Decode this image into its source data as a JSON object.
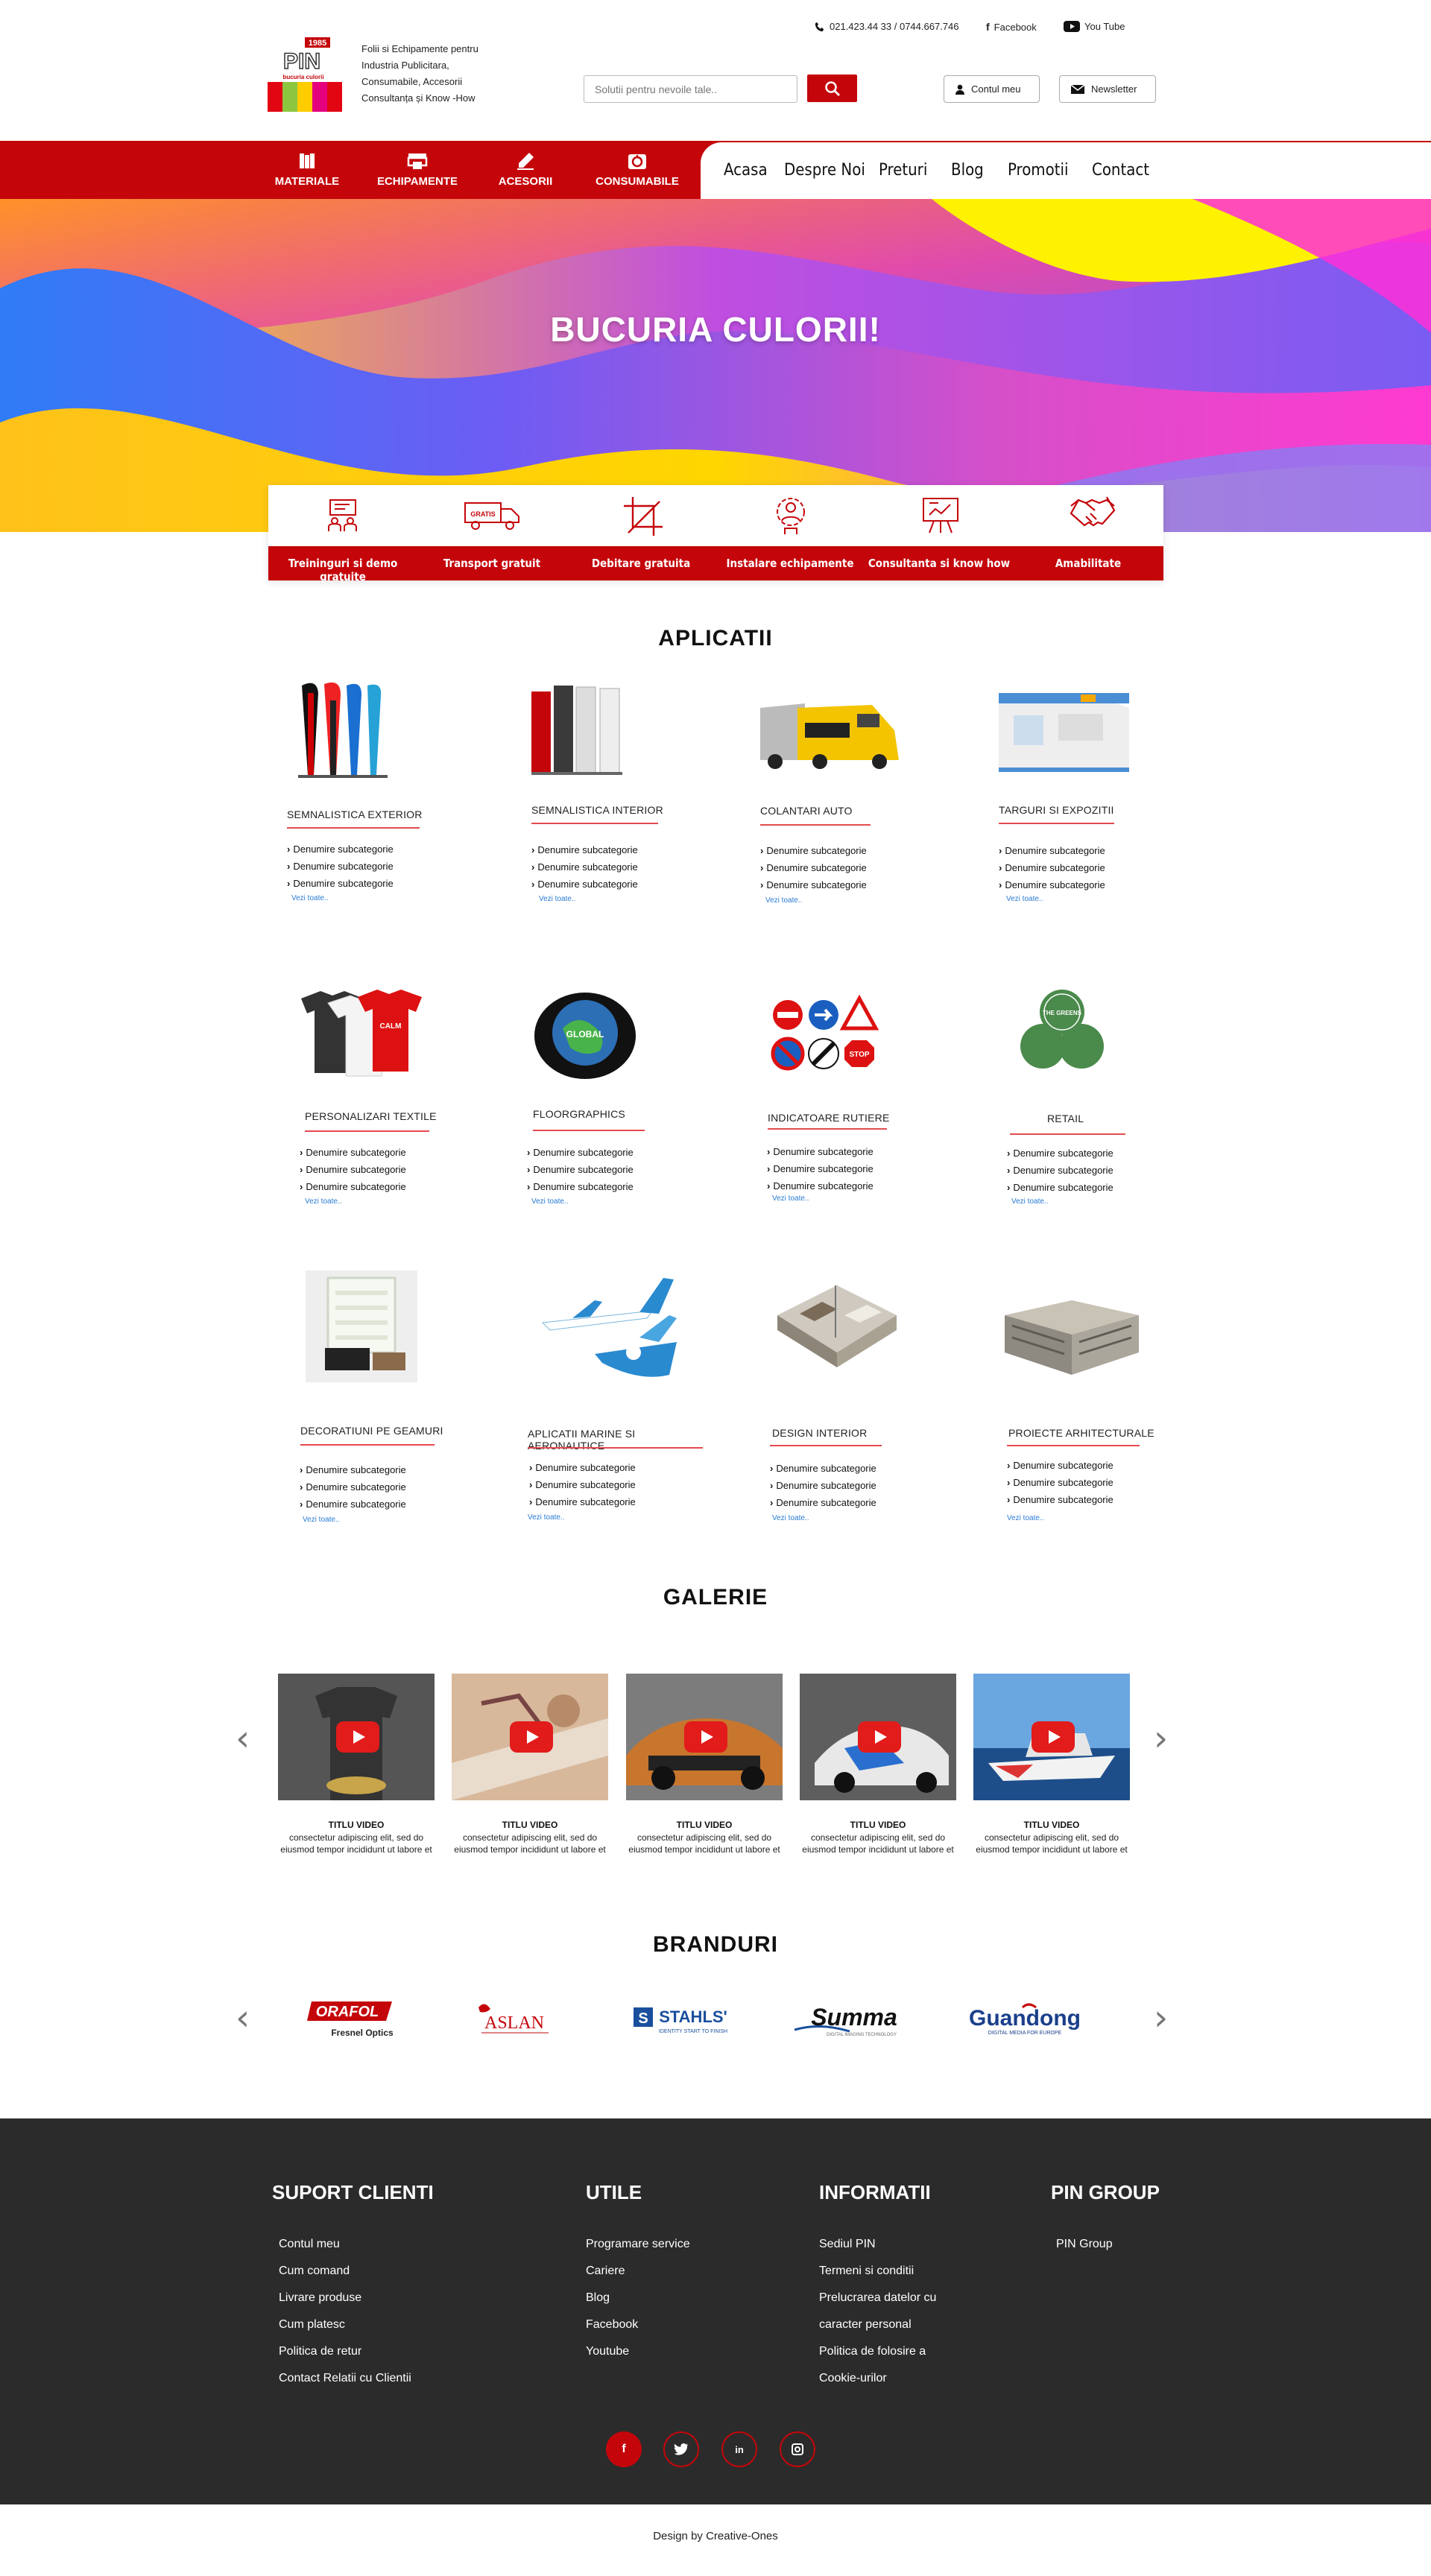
{
  "brand": {
    "logo_badge": "1985",
    "logo_text": "PIN",
    "logo_sub": "bucuria culorii",
    "tagline": [
      "Folii si Echipamente pentru",
      "Industria Publicitara,",
      "Consumabile, Accesorii",
      "Consultanța și Know -How"
    ]
  },
  "header": {
    "phone": "021.423.44 33 / 0744.667.746",
    "facebook": "Facebook",
    "youtube": "You Tube",
    "search_placeholder": "Solutii pentru nevoile tale..",
    "account": "Contul meu",
    "newsletter": "Newsletter"
  },
  "nav": {
    "categories": [
      "MATERIALE",
      "ECHIPAMENTE",
      "ACESORII",
      "CONSUMABILE"
    ],
    "menu": [
      "Acasa",
      "Despre Noi",
      "Preturi",
      "Blog",
      "Promotii",
      "Contact"
    ]
  },
  "hero": {
    "title": "BUCURIA CULORII!"
  },
  "features": [
    "Treininguri si demo gratuite",
    "Transport  gratuit",
    "Debitare gratuita",
    "Instalare echipamente",
    "Consultanta si know how",
    "Amabilitate"
  ],
  "features_badge": "GRATIS",
  "apps": {
    "title": "APLICATII",
    "items": [
      {
        "title": "SEMNALISTICA EXTERIOR",
        "subs": [
          "Denumire subcategorie",
          "Denumire subcategorie",
          "Denumire subcategorie"
        ],
        "more": "Vezi toate.."
      },
      {
        "title": "SEMNALISTICA INTERIOR",
        "subs": [
          "Denumire subcategorie",
          "Denumire subcategorie",
          "Denumire subcategorie"
        ],
        "more": "Vezi toate.."
      },
      {
        "title": "COLANTARI AUTO",
        "subs": [
          "Denumire subcategorie",
          "Denumire subcategorie",
          "Denumire subcategorie"
        ],
        "more": "Vezi toate.."
      },
      {
        "title": "TARGURI SI EXPOZITII",
        "subs": [
          "Denumire subcategorie",
          "Denumire subcategorie",
          "Denumire subcategorie"
        ],
        "more": "Vezi toate.."
      },
      {
        "title": "PERSONALIZARI TEXTILE",
        "subs": [
          "Denumire subcategorie",
          "Denumire subcategorie",
          "Denumire subcategorie"
        ],
        "more": "Vezi toate.."
      },
      {
        "title": "FLOORGRAPHICS",
        "subs": [
          "Denumire subcategorie",
          "Denumire subcategorie",
          "Denumire subcategorie"
        ],
        "more": "Vezi toate.."
      },
      {
        "title": "INDICATOARE RUTIERE",
        "subs": [
          "Denumire subcategorie",
          "Denumire subcategorie",
          "Denumire subcategorie"
        ],
        "more": "Vezi toate.."
      },
      {
        "title": "RETAIL",
        "subs": [
          "Denumire subcategorie",
          "Denumire subcategorie",
          "Denumire subcategorie"
        ],
        "more": "Vezi toate.."
      },
      {
        "title": "DECORATIUNI PE GEAMURI",
        "subs": [
          "Denumire subcategorie",
          "Denumire subcategorie",
          "Denumire subcategorie"
        ],
        "more": "Vezi toate.."
      },
      {
        "title": "APLICATII MARINE SI AERONAUTICE",
        "subs": [
          "Denumire subcategorie",
          "Denumire subcategorie",
          "Denumire subcategorie"
        ],
        "more": "Vezi toate.."
      },
      {
        "title": "DESIGN INTERIOR",
        "subs": [
          "Denumire subcategorie",
          "Denumire subcategorie",
          "Denumire subcategorie"
        ],
        "more": "Vezi toate.."
      },
      {
        "title": "PROIECTE ARHITECTURALE",
        "subs": [
          "Denumire subcategorie",
          "Denumire subcategorie",
          "Denumire subcategorie"
        ],
        "more": "Vezi toate.."
      }
    ],
    "image_labels": {
      "tshirt": "CALM",
      "floor": "GLOBAL",
      "retail": "THE GREENS",
      "stop": "STOP"
    }
  },
  "gallery": {
    "title": "GALERIE",
    "items": [
      {
        "title": "TITLU VIDEO",
        "desc": "consectetur adipiscing elit, sed do eiusmod tempor incididunt ut labore et"
      },
      {
        "title": "TITLU VIDEO",
        "desc": "consectetur adipiscing elit, sed do eiusmod tempor incididunt ut labore et"
      },
      {
        "title": "TITLU VIDEO",
        "desc": "consectetur adipiscing elit, sed do eiusmod tempor incididunt ut labore et"
      },
      {
        "title": "TITLU VIDEO",
        "desc": "consectetur adipiscing elit, sed do eiusmod tempor incididunt ut labore et"
      },
      {
        "title": "TITLU VIDEO",
        "desc": "consectetur adipiscing elit, sed do eiusmod tempor incididunt ut labore et"
      }
    ]
  },
  "brands": {
    "title": "BRANDURI",
    "items": [
      "ORAFOL",
      "ASLAN",
      "STAHLS'",
      "Summa",
      "Guandong"
    ],
    "orafol_sub": "Fresnel Optics",
    "stahls_sub": "IDENTITY START TO FINISH",
    "summa_sub": "DIGITAL IMAGING TECHNOLOGY",
    "guandong_sub": "DIGITAL MEDIA FOR EUROPE"
  },
  "footer": {
    "cols": [
      {
        "title": "SUPORT CLIENTI",
        "links": [
          "Contul meu",
          "Cum comand",
          "Livrare produse",
          "Cum platesc",
          "Politica de retur",
          "Contact Relatii cu Clientii"
        ]
      },
      {
        "title": "UTILE",
        "links": [
          "Programare service",
          "Cariere",
          "Blog",
          "Facebook",
          "Youtube"
        ]
      },
      {
        "title": "INFORMATII",
        "links": [
          "Sediul PIN",
          "Termeni si conditii",
          "Prelucrarea datelor cu",
          "caracter personal",
          "Politica de folosire a",
          "Cookie-urilor"
        ]
      },
      {
        "title": "PIN GROUP",
        "links": [
          "PIN Group"
        ]
      }
    ],
    "social": [
      "facebook-icon",
      "twitter-icon",
      "linkedin-icon",
      "instagram-icon"
    ],
    "credit": "Design by Creative-Ones"
  },
  "colors": {
    "primary": "#c4060b",
    "footer_bg": "#2b2b2b",
    "link": "#2a7bd4"
  }
}
